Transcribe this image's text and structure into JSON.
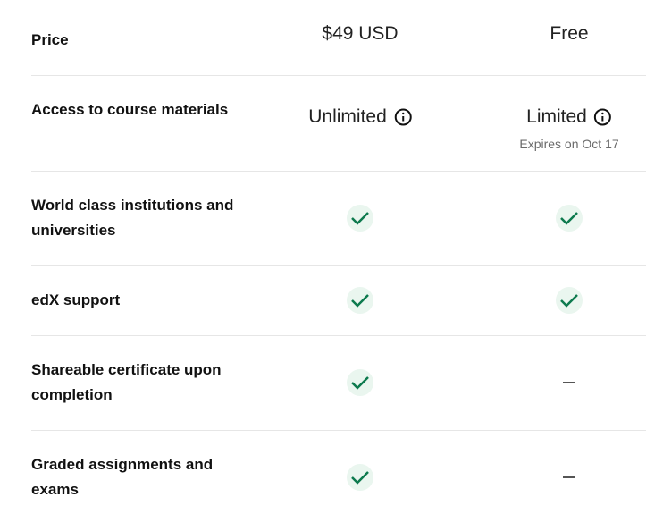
{
  "rows": {
    "price": {
      "label": "Price",
      "col_a": "$49 USD",
      "col_b": "Free"
    },
    "access": {
      "label": "Access to course materials",
      "col_a": "Unlimited",
      "col_b": "Limited",
      "col_b_sub": "Expires on Oct 17"
    },
    "institutions": {
      "label": "World class institutions and universities",
      "col_a": "check",
      "col_b": "check"
    },
    "support": {
      "label": "edX support",
      "col_a": "check",
      "col_b": "check"
    },
    "certificate": {
      "label": "Shareable certificate upon completion",
      "col_a": "check",
      "col_b": "dash"
    },
    "graded": {
      "label": "Graded assignments and exams",
      "col_a": "check",
      "col_b": "dash"
    }
  },
  "colors": {
    "check": "#0d7a4e",
    "check_bg": "#eaf6ef",
    "divider": "#e6e6e6"
  },
  "icons": {
    "info": "info-icon",
    "check": "check-icon",
    "dash": "dash-icon"
  }
}
